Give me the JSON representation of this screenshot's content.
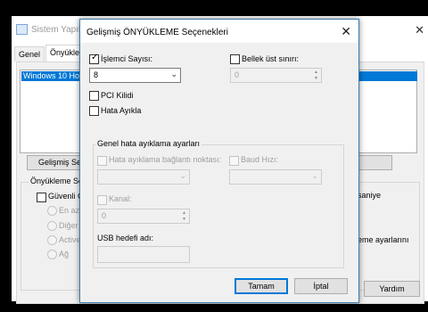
{
  "background_window": {
    "title": "Sistem Yapıla",
    "tabs": [
      "Genel",
      "Önyükle"
    ],
    "list_selected": "Windows 10 Ho",
    "advanced_button": "Gelişmiş Se",
    "boot_options_label": "Önyükleme Se",
    "safe_boot": "Güvenli Ö",
    "radio_options": [
      "En az",
      "Diğer",
      "Active",
      "Ağ"
    ],
    "right_text_1": "saniye",
    "right_text_2": "eme ayarlarını",
    "help_button": "Yardım"
  },
  "dialog": {
    "title": "Gelişmiş ÖNYÜKLEME Seçenekleri",
    "processor_count_label": "İşlemci Sayısı:",
    "processor_count_checked": true,
    "processor_count_value": "8",
    "memory_limit_label": "Bellek üst sınırı:",
    "memory_limit_value": "0",
    "pci_lock_label": "PCI Kilidi",
    "debug_label": "Hata Ayıkla",
    "debug_group_label": "Genel hata ayıklama ayarları",
    "debug_port_label": "Hata ayıklama bağlantı noktası:",
    "baud_rate_label": "Baud Hızı:",
    "channel_label": "Kanal:",
    "channel_value": "0",
    "usb_target_label": "USB hedefi adı:",
    "ok_button": "Tamam",
    "cancel_button": "İptal"
  }
}
